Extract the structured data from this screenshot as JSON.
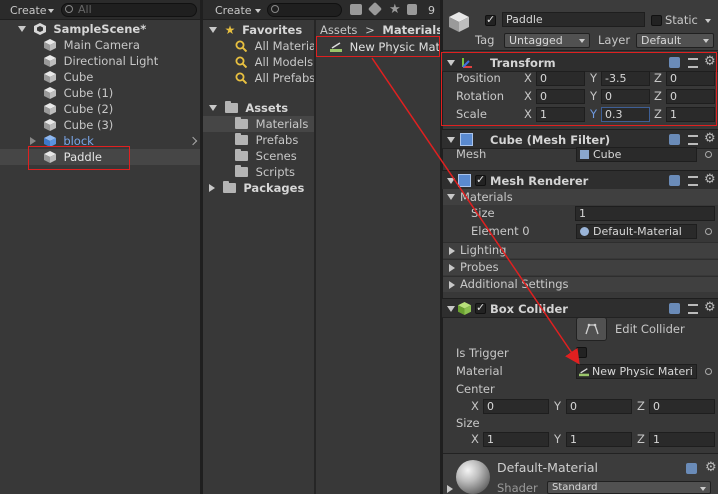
{
  "hierarchy": {
    "create_label": "Create",
    "search_placeholder": "All",
    "scene_name": "SampleScene*",
    "items": [
      "Main Camera",
      "Directional Light",
      "Cube",
      "Cube (1)",
      "Cube (2)",
      "Cube (3)",
      "block",
      "Paddle"
    ]
  },
  "project": {
    "create_label": "Create",
    "badge_count": "9",
    "favorites_label": "Favorites",
    "favorites": [
      "All Materia",
      "All Models",
      "All Prefabs"
    ],
    "assets_label": "Assets",
    "asset_folders": [
      "Materials",
      "Prefabs",
      "Scenes",
      "Scripts"
    ],
    "packages_label": "Packages",
    "breadcrumb": {
      "root": "Assets",
      "separator": ">",
      "current": "Materials"
    },
    "files": [
      "New Physic Mate"
    ]
  },
  "inspector": {
    "object_name": "Paddle",
    "static_label": "Static",
    "tag_label": "Tag",
    "tag_value": "Untagged",
    "layer_label": "Layer",
    "layer_value": "Default",
    "transform": {
      "title": "Transform",
      "position": {
        "label": "Position",
        "x": "0",
        "y": "-3.5",
        "z": "0"
      },
      "rotation": {
        "label": "Rotation",
        "x": "0",
        "y": "0",
        "z": "0"
      },
      "scale": {
        "label": "Scale",
        "x": "1",
        "y": "0.3",
        "z": "1"
      }
    },
    "axis": {
      "x": "X",
      "y": "Y",
      "z": "Z"
    },
    "mesh_filter": {
      "title": "Cube (Mesh Filter)",
      "mesh_label": "Mesh",
      "mesh_value": "Cube"
    },
    "mesh_renderer": {
      "title": "Mesh Renderer",
      "materials_label": "Materials",
      "size_label": "Size",
      "size_value": "1",
      "element_label": "Element 0",
      "element_value": "Default-Material",
      "lighting": "Lighting",
      "probes": "Probes",
      "additional": "Additional Settings"
    },
    "box_collider": {
      "title": "Box Collider",
      "edit_label": "Edit Collider",
      "trigger_label": "Is Trigger",
      "material_label": "Material",
      "material_value": "New Physic Materi",
      "center_label": "Center",
      "center": {
        "x": "0",
        "y": "0",
        "z": "0"
      },
      "size_label": "Size",
      "size": {
        "x": "1",
        "y": "1",
        "z": "1"
      }
    },
    "material_preview": {
      "name": "Default-Material",
      "shader_label": "Shader",
      "shader_value": "Standard"
    }
  },
  "colors": {
    "accent": "#3e5f96",
    "highlight_red": "#e02020",
    "selected_row": "#464646"
  }
}
